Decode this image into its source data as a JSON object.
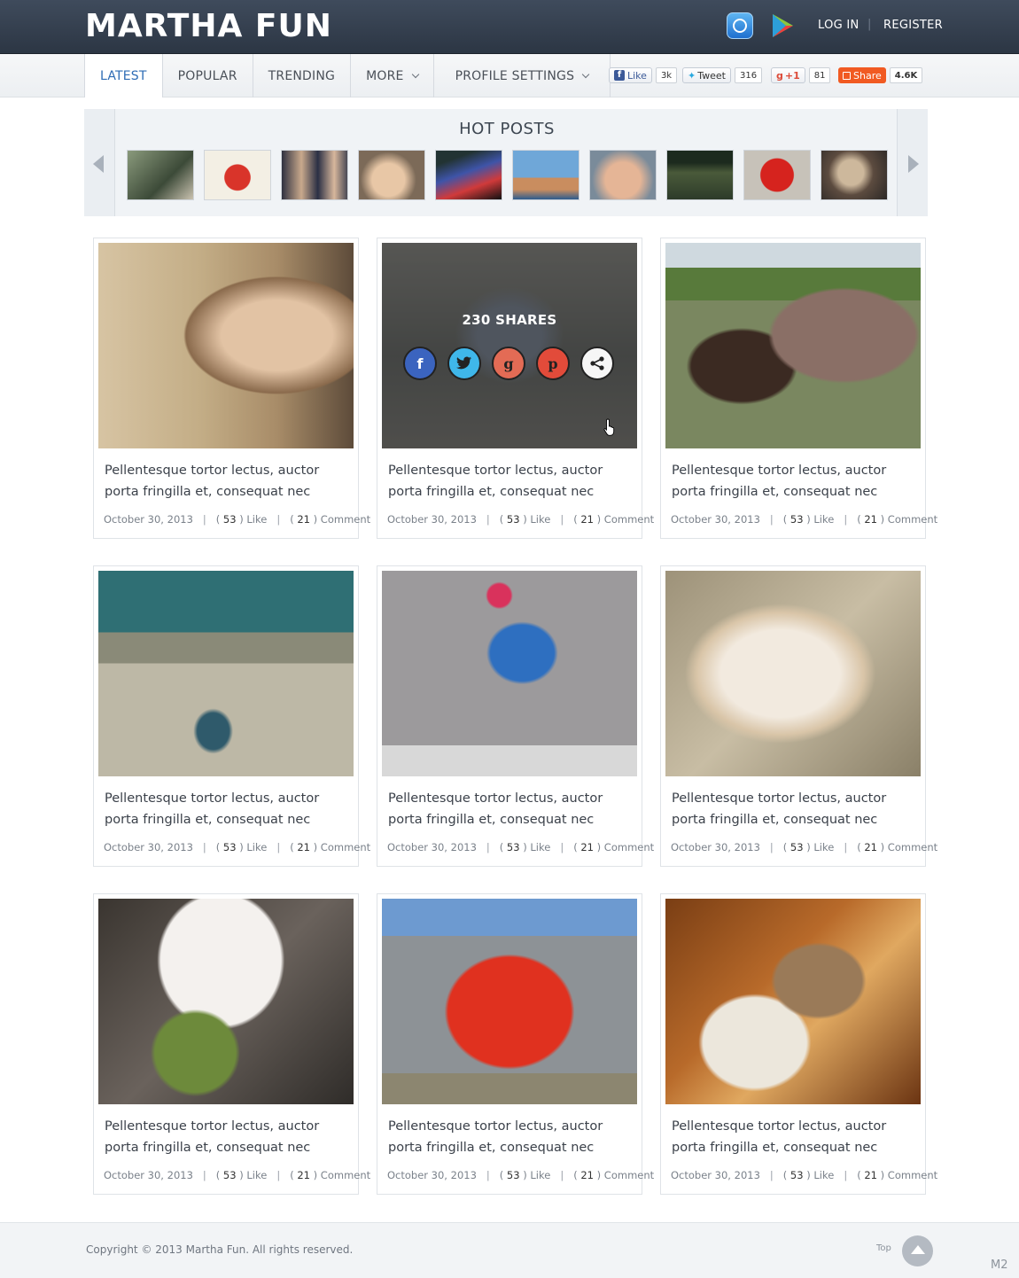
{
  "brand": {
    "logo": "MARTHA FUN"
  },
  "header": {
    "login": "LOG IN",
    "separator": "|",
    "register": "REGISTER",
    "icons": [
      "app-store-icon",
      "google-play-icon"
    ]
  },
  "nav": {
    "items": [
      "LATEST",
      "POPULAR",
      "TRENDING",
      "MORE",
      "PROFILE SETTINGS"
    ],
    "active": "LATEST"
  },
  "social": {
    "facebook": {
      "label": "Like",
      "count": "3k"
    },
    "twitter": {
      "label": "Tweet",
      "count": "316"
    },
    "gplus": {
      "label": "+1",
      "count": "81"
    },
    "share": {
      "label": "Share",
      "count": "4.6K"
    }
  },
  "hot_posts": {
    "title": "HOT POSTS",
    "thumb_count": 10
  },
  "overlay": {
    "shares_label": "230 SHARES",
    "icons": [
      "facebook-icon",
      "twitter-icon",
      "google-plus-icon",
      "pinterest-icon",
      "share-icon"
    ]
  },
  "posts": [
    {
      "title": "Pellentesque tortor lectus, auctor porta fringilla et, consequat nec",
      "date": "October 30, 2013",
      "likes": "53",
      "comments": "21"
    },
    {
      "title": "Pellentesque tortor lectus, auctor porta fringilla et, consequat nec",
      "date": "October 30, 2013",
      "likes": "53",
      "comments": "21"
    },
    {
      "title": "Pellentesque tortor lectus, auctor porta fringilla et, consequat nec",
      "date": "October 30, 2013",
      "likes": "53",
      "comments": "21"
    },
    {
      "title": "Pellentesque tortor lectus, auctor porta fringilla et, consequat nec",
      "date": "October 30, 2013",
      "likes": "53",
      "comments": "21"
    },
    {
      "title": "Pellentesque tortor lectus, auctor porta fringilla et, consequat nec",
      "date": "October 30, 2013",
      "likes": "53",
      "comments": "21"
    },
    {
      "title": "Pellentesque tortor lectus, auctor porta fringilla et, consequat nec",
      "date": "October 30, 2013",
      "likes": "53",
      "comments": "21"
    },
    {
      "title": "Pellentesque tortor lectus, auctor porta fringilla et, consequat nec",
      "date": "October 30, 2013",
      "likes": "53",
      "comments": "21"
    },
    {
      "title": "Pellentesque tortor lectus, auctor porta fringilla et, consequat nec",
      "date": "October 30, 2013",
      "likes": "53",
      "comments": "21"
    },
    {
      "title": "Pellentesque tortor lectus, auctor porta fringilla et, consequat nec",
      "date": "October 30, 2013",
      "likes": "53",
      "comments": "21"
    }
  ],
  "meta_labels": {
    "like": "Like",
    "comment": "Comment"
  },
  "footer": {
    "copyright": "Copyright  ©  2013  Martha Fun.   All rights reserved.",
    "top_label": "Top",
    "corner": "M2"
  },
  "colors": {
    "header": "#36414f",
    "accent": "#2e6cb5",
    "share": "#f15a22"
  }
}
